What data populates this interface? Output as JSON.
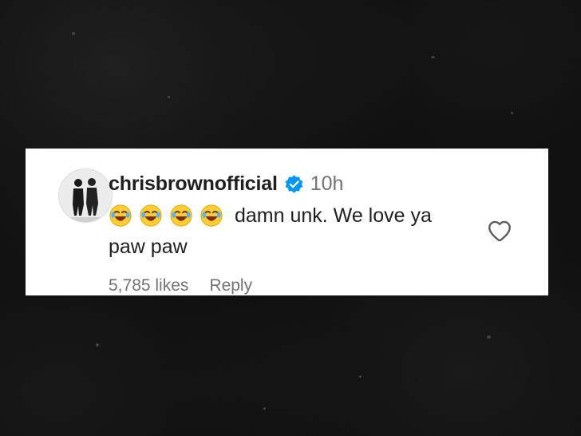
{
  "comment": {
    "username": "chrisbrownofficial",
    "verified": true,
    "timestamp": "10h",
    "text_line1": "damn unk. We love ya",
    "text_line2": "paw paw",
    "emoji_count": 4,
    "emoji_name": "face-with-tears-of-joy",
    "likes": "5,785 likes",
    "reply_label": "Reply"
  },
  "colors": {
    "background": "#0a0a0a",
    "card": "#ffffff",
    "username": "#1f1f1f",
    "muted": "#737373",
    "verified_badge": "#0095f6"
  },
  "icons": [
    "avatar",
    "verified-badge-icon",
    "laughing-emoji-icon",
    "heart-icon"
  ]
}
